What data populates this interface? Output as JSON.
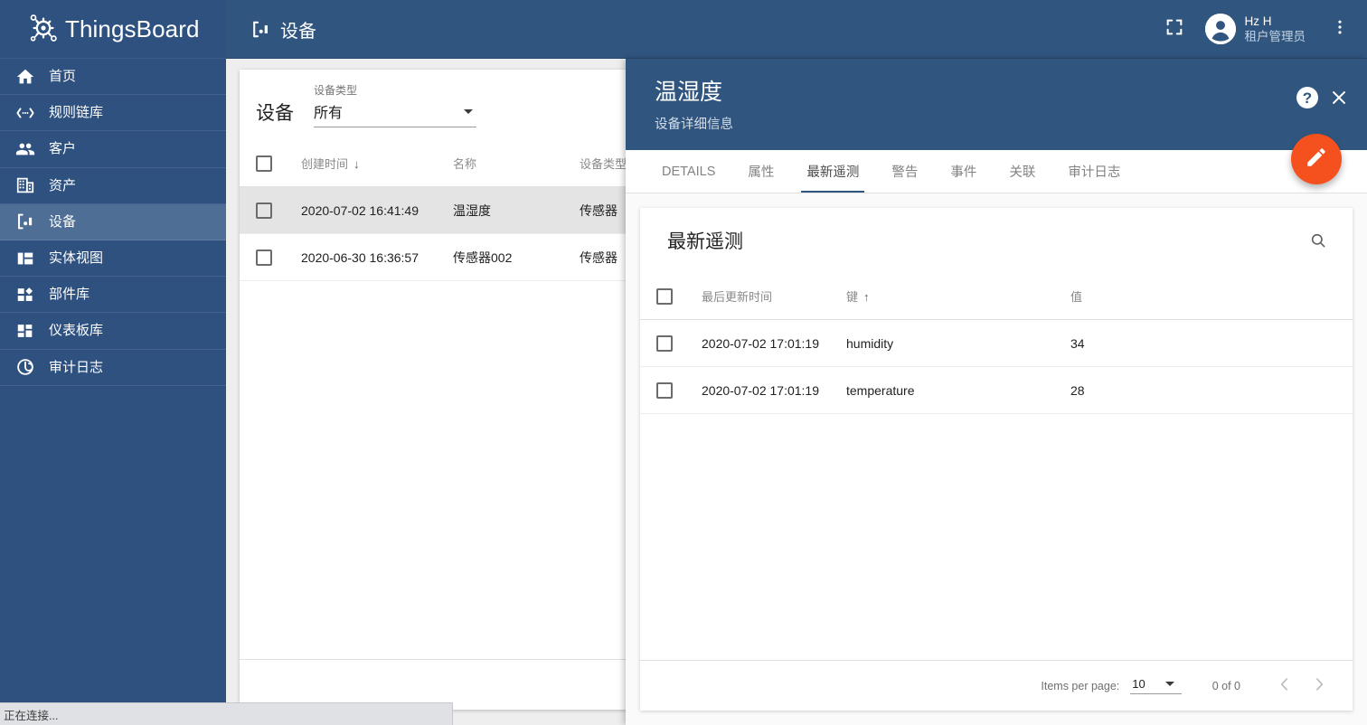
{
  "brand": {
    "name": "ThingsBoard",
    "logo_icon": "thingsboard-gear-logo",
    "header_color": "#305680",
    "sidebar_color": "#2e5180",
    "sidebar_active_color": "#4e6e96",
    "accent_color": "#f4511e"
  },
  "sidebar": {
    "items": [
      {
        "label": "首页",
        "icon": "home-icon",
        "active": false
      },
      {
        "label": "规则链库",
        "icon": "rule-chain-icon",
        "active": false
      },
      {
        "label": "客户",
        "icon": "customers-icon",
        "active": false
      },
      {
        "label": "资产",
        "icon": "assets-icon",
        "active": false
      },
      {
        "label": "设备",
        "icon": "devices-icon",
        "active": true
      },
      {
        "label": "实体视图",
        "icon": "entity-view-icon",
        "active": false
      },
      {
        "label": "部件库",
        "icon": "widget-library-icon",
        "active": false
      },
      {
        "label": "仪表板库",
        "icon": "dashboard-icon",
        "active": false
      },
      {
        "label": "审计日志",
        "icon": "audit-log-icon",
        "active": false
      }
    ]
  },
  "topbar": {
    "title": "设备",
    "title_icon": "devices-icon",
    "fullscreen_icon": "fullscreen-icon",
    "avatar_icon": "account-circle-icon",
    "user_name": "Hz H",
    "user_role": "租户管理员",
    "more_icon": "more-vert-icon"
  },
  "device_list": {
    "title": "设备",
    "filter": {
      "label": "设备类型",
      "value": "所有",
      "dropdown_icon": "chevron-down-icon"
    },
    "columns": [
      "创建时间",
      "名称",
      "设备类型"
    ],
    "sort_column": "创建时间",
    "sort_icon": "arrow-down-icon",
    "rows": [
      {
        "created": "2020-07-02 16:41:49",
        "name": "温湿度",
        "type": "传感器",
        "selected": true
      },
      {
        "created": "2020-06-30 16:36:57",
        "name": "传感器002",
        "type": "传感器",
        "selected": false
      }
    ]
  },
  "details": {
    "title": "温湿度",
    "subtitle": "设备详细信息",
    "help_icon": "help-icon",
    "close_icon": "close-icon",
    "edit_fab_icon": "pencil-icon",
    "tabs": [
      {
        "label": "DETAILS",
        "active": false
      },
      {
        "label": "属性",
        "active": false
      },
      {
        "label": "最新遥测",
        "active": true
      },
      {
        "label": "警告",
        "active": false
      },
      {
        "label": "事件",
        "active": false
      },
      {
        "label": "关联",
        "active": false
      },
      {
        "label": "审计日志",
        "active": false
      }
    ]
  },
  "telemetry": {
    "title": "最新遥测",
    "search_icon": "search-icon",
    "columns": [
      "最后更新时间",
      "键",
      "值"
    ],
    "sort_column": "键",
    "sort_icon": "arrow-up-icon",
    "rows": [
      {
        "updated": "2020-07-02 17:01:19",
        "key": "humidity",
        "value": "34"
      },
      {
        "updated": "2020-07-02 17:01:19",
        "key": "temperature",
        "value": "28"
      }
    ],
    "paginator": {
      "items_per_page_label": "Items per page:",
      "items_per_page_value": "10",
      "dropdown_icon": "chevron-down-icon",
      "range_label": "0 of 0",
      "prev_icon": "chevron-left-icon",
      "next_icon": "chevron-right-icon"
    }
  },
  "statusbar": {
    "text": "正在连接..."
  }
}
